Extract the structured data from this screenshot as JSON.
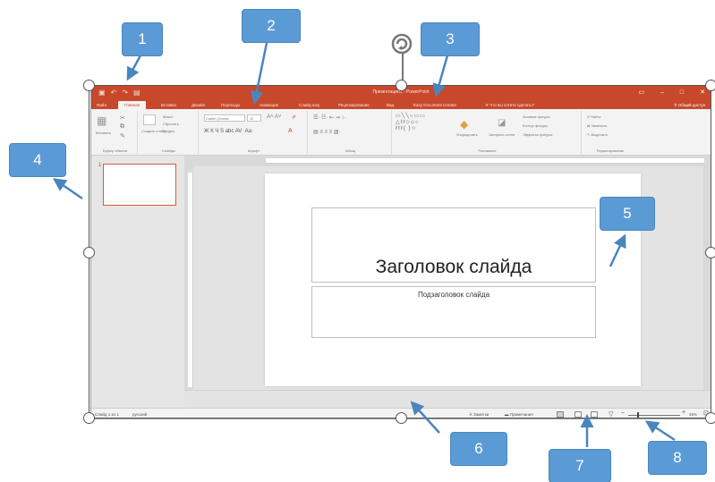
{
  "window": {
    "doc_title": "Презентация1 - PowerPoint",
    "qat_icons": [
      "save-icon",
      "undo-icon",
      "redo-icon",
      "slideshow-icon"
    ],
    "share_label": "Общий доступ"
  },
  "tabs": [
    {
      "label": "Файл"
    },
    {
      "label": "Главная",
      "active": true
    },
    {
      "label": "Вставка"
    },
    {
      "label": "Дизайн"
    },
    {
      "label": "Переходы"
    },
    {
      "label": "Анимация"
    },
    {
      "label": "Слайд-шоу"
    },
    {
      "label": "Рецензирование"
    },
    {
      "label": "Вид"
    },
    {
      "label": "Easy Document Creator"
    },
    {
      "label": "Что вы хотите сделать?"
    }
  ],
  "ribbon": {
    "clipboard": {
      "paste": "Вставить",
      "label": "Буфер обмена"
    },
    "slides": {
      "create": "Создать слайд",
      "layout": "Макет",
      "reset": "Сбросить",
      "section": "Раздел",
      "label": "Слайды"
    },
    "font": {
      "name": "Calibri (Основ",
      "size": "12",
      "label": "Шрифт"
    },
    "paragraph": {
      "label": "Абзац"
    },
    "drawing": {
      "arrange": "Упорядочить",
      "quick_styles": "Экспресс-стили",
      "fill": "Заливка фигуры",
      "outline": "Контур фигуры",
      "effects": "Эффекты фигуры",
      "label": "Рисование"
    },
    "editing": {
      "find": "Найти",
      "replace": "Заменить",
      "select": "Выделить",
      "label": "Редактирование"
    }
  },
  "thumbnails": [
    {
      "number": "1"
    }
  ],
  "slide": {
    "title": "Заголовок слайда",
    "subtitle": "Подзаголовок слайда"
  },
  "status": {
    "slide_info": "Слайд 1 из 1",
    "language": "русский",
    "notes": "Заметки",
    "comments": "Примечания",
    "zoom": "45%"
  },
  "callouts": [
    "1",
    "2",
    "3",
    "4",
    "5",
    "6",
    "7",
    "8"
  ],
  "colors": {
    "accent": "#c8482c",
    "callout": "#5b9bd5"
  }
}
